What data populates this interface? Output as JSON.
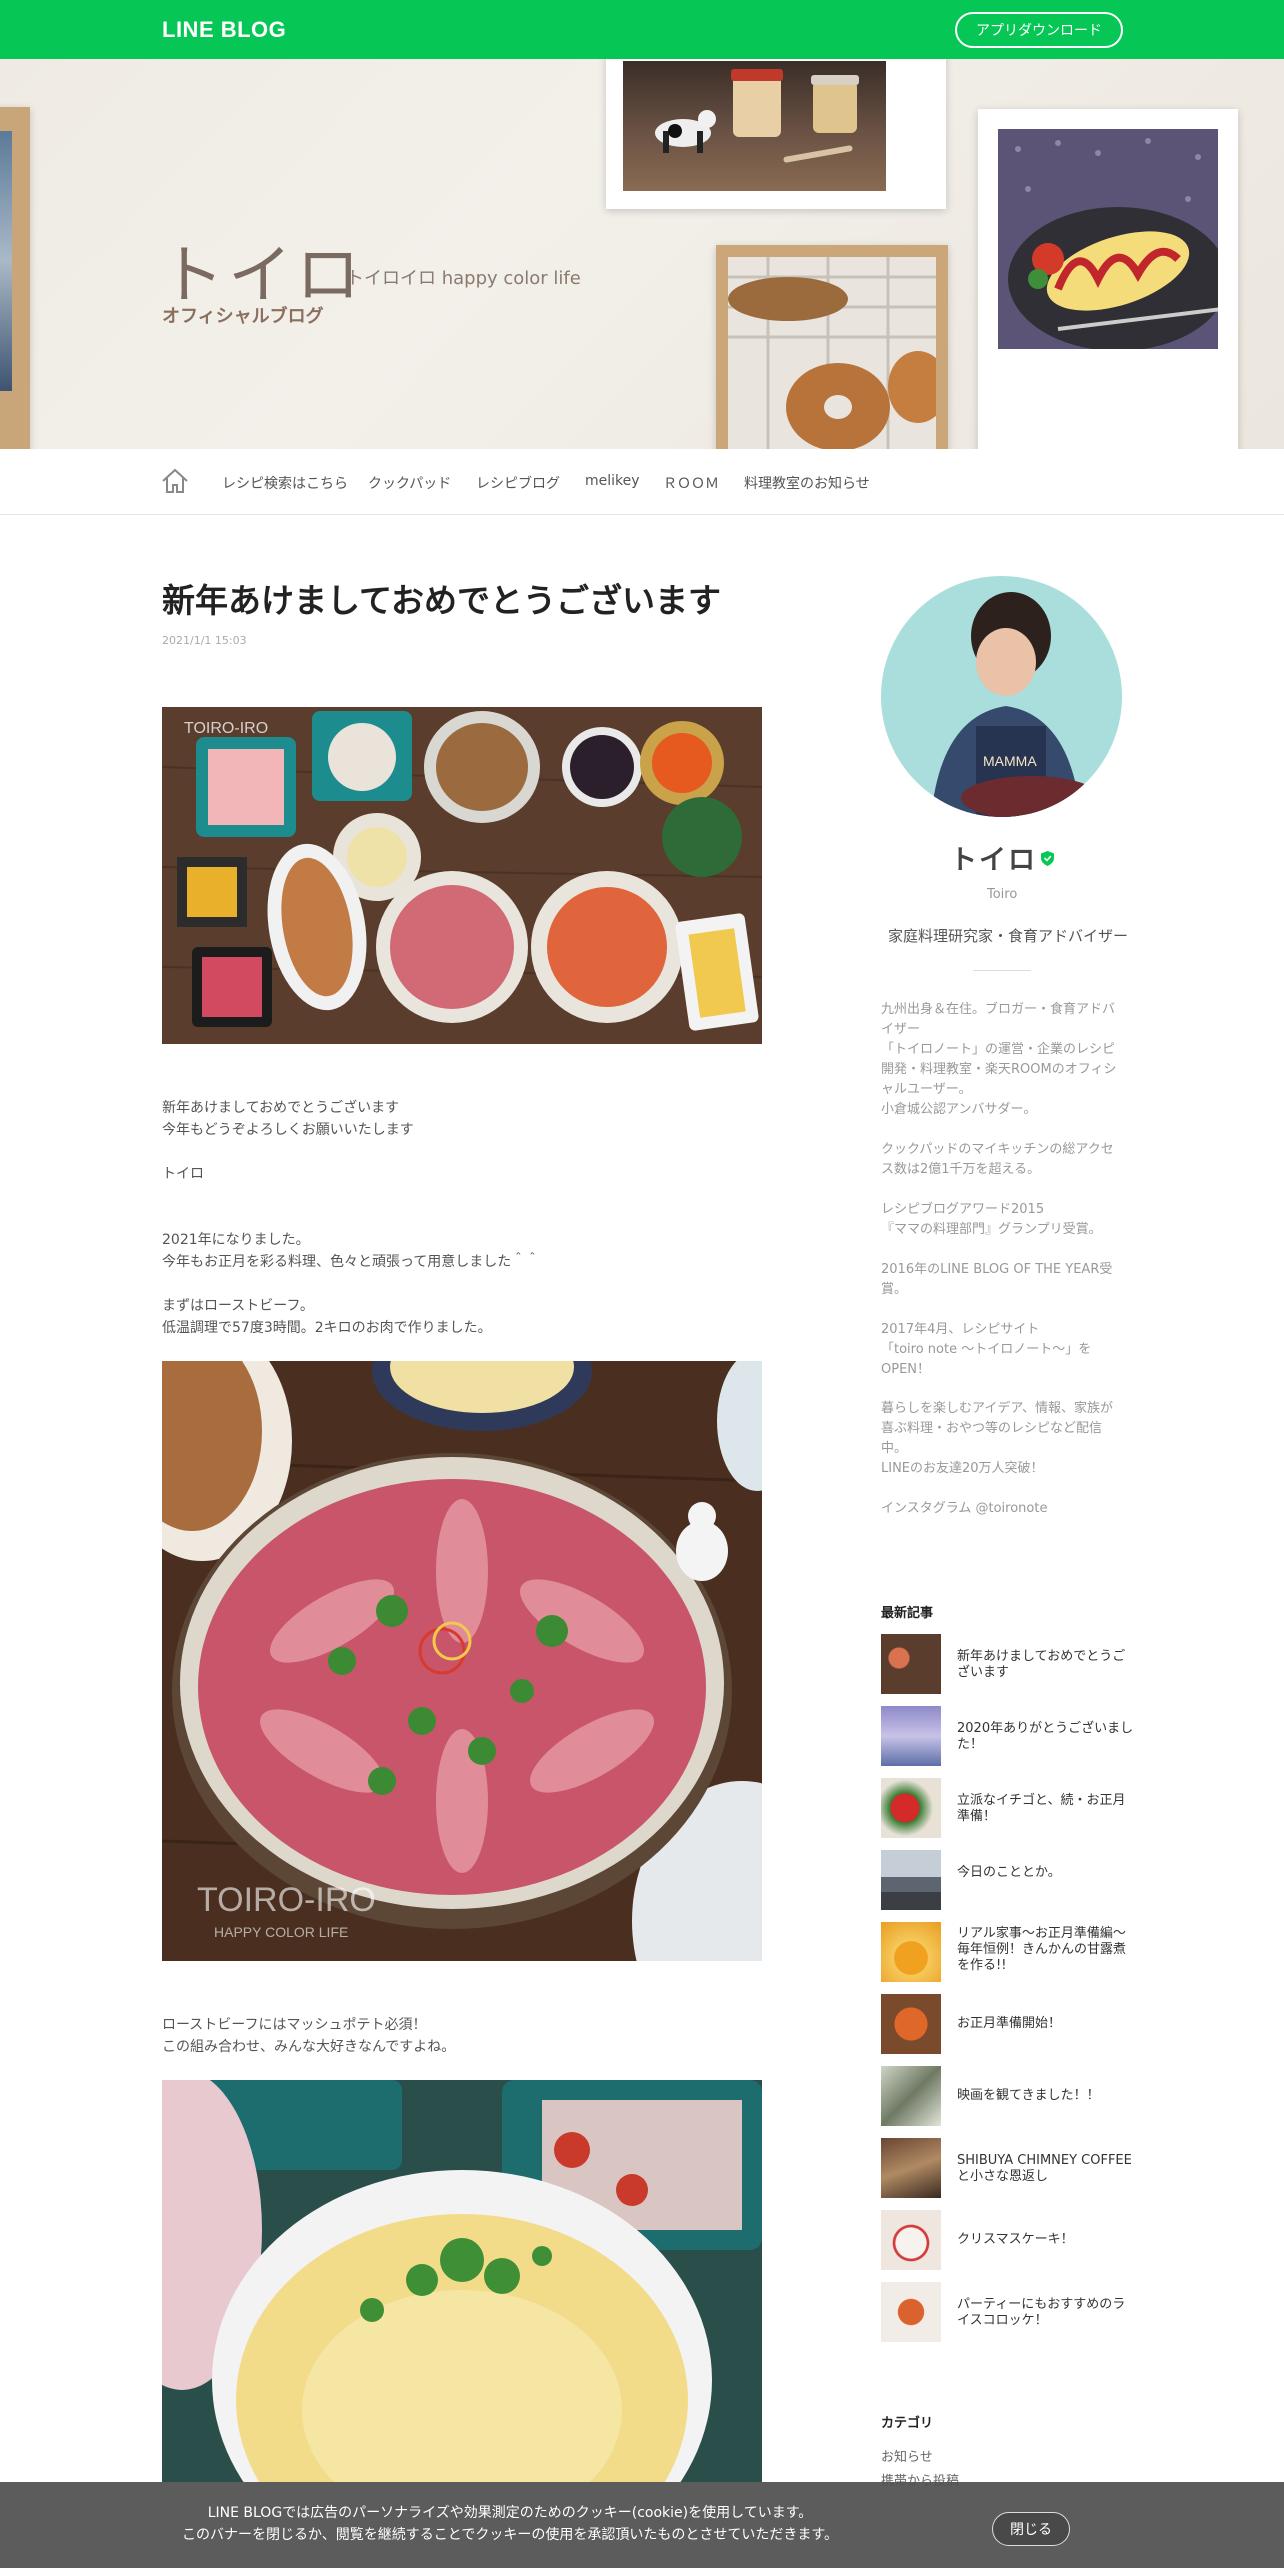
{
  "topbar": {
    "logo": "LINE BLOG",
    "download_button": "アプリダウンロード"
  },
  "hero": {
    "title": "トイロ",
    "subtitle": "トイロイロ happy color life",
    "official": "オフィシャルブログ"
  },
  "nav": {
    "items": [
      "レシピ検索はこちら",
      "クックパッド",
      "レシピブログ",
      "melikey",
      "ＲＯＯＭ",
      "料理教室のお知らせ"
    ]
  },
  "post": {
    "title": "新年あけましておめでとうございます",
    "date": "2021/1/1 15:03",
    "para1": "新年あけましておめでとうございます\n今年もどうぞよろしくお願いいたします\n\nトイロ",
    "para2": "2021年になりました。\n今年もお正月を彩る料理、色々と頑張って用意しました＾＾\n\nまずはローストビーフ。\n低温調理で57度3時間。2キロのお肉で作りました。",
    "para3": "ローストビーフにはマッシュポテト必須！\nこの組み合わせ、みんな大好きなんですよね。",
    "watermark_1": "TOIRO-IRO",
    "watermark_2": "TOIRO-IRO",
    "watermark_2_sub": "HAPPY COLOR LIFE"
  },
  "profile": {
    "name": "トイロ",
    "roman": "Toiro",
    "title": "家庭料理研究家・食育アドバイザー",
    "bio": [
      "九州出身＆在住。ブロガー・食育アドバ\nイザー\n「トイロノート」の運営・企業のレシピ\n開発・料理教室・楽天ROOMのオフィシ\nャルユーザー。\n小倉城公認アンバサダー。",
      "クックパッドのマイキッチンの総アクセ\nス数は2億1千万を超える。",
      "レシピブログアワード2015\n『ママの料理部門』グランプリ受賞。",
      "2016年のLINE BLOG OF THE YEAR受\n賞。",
      "2017年4月、レシピサイト\n「toiro note 〜トイロノート〜」を\nOPEN！",
      "暮らしを楽しむアイデア、情報、家族が\n喜ぶ料理・おやつ等のレシピなど配信\n中。\nLINEのお友達20万人突破！",
      "インスタグラム @toironote"
    ]
  },
  "recent": {
    "heading": "最新記事",
    "items": [
      "新年あけましておめでとうご\nざいます",
      "2020年ありがとうございまし\nた！",
      "立派なイチゴと、続・お正月\n準備！",
      "今日のこととか。",
      "リアル家事〜お正月準備編〜\n毎年恒例！きんかんの甘露煮\nを作る!!",
      "お正月準備開始！",
      "映画を観てきました！！",
      "SHIBUYA CHIMNEY COFFEE\nと小さな恩返し",
      "クリスマスケーキ！",
      "パーティーにもおすすめのラ\nイスコロッケ！"
    ]
  },
  "categories": {
    "heading": "カテゴリ",
    "items": [
      "お知らせ",
      "携帯から投稿"
    ]
  },
  "cookie": {
    "text": "LINE BLOGでは広告のパーソナライズや効果測定のためのクッキー(cookie)を使用しています。\nこのバナーを閉じるか、閲覧を継続することでクッキーの使用を承認頂いたものとさせていただきます。",
    "close": "閉じる"
  },
  "colors": {
    "brand": "#06c755",
    "badge": "#06c755"
  }
}
